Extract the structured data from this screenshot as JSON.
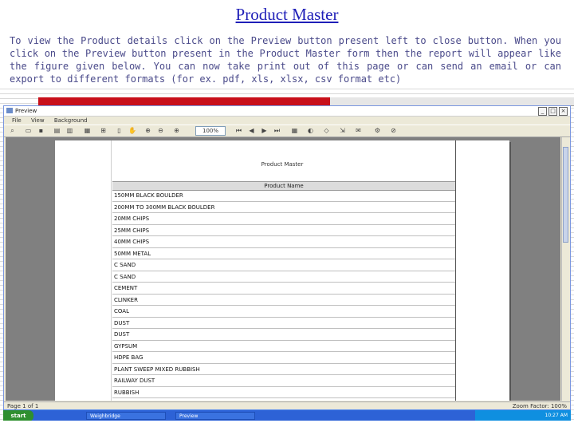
{
  "page_title": "Product Master",
  "intro_text": "To view the Product details click on the Preview button present left to close button. When you click on the Preview button present in the Product Master form then the report will appear like the figure given below. You can now take print out of this page or can send an email or can export to different formats (for ex. pdf, xls, xlsx, csv format etc)",
  "window": {
    "title": "Preview",
    "menu": [
      "File",
      "View",
      "Background"
    ],
    "zoom": "100%",
    "status_left": "Page 1 of 1",
    "status_right": "Zoom Factor: 100%"
  },
  "report": {
    "title": "Product Master",
    "column_header": "Product Name",
    "rows": [
      "150MM BLACK BOULDER",
      "200MM TO 300MM BLACK BOULDER",
      "20MM CHIPS",
      "25MM CHIPS",
      "40MM CHIPS",
      "50MM METAL",
      "C SAND",
      "C SAND",
      "CEMENT",
      "CLINKER",
      "COAL",
      "DUST",
      "DUST",
      "GYPSUM",
      "HDPE BAG",
      "PLANT SWEEP MIXED RUBBISH",
      "RAILWAY DUST",
      "RUBBISH"
    ]
  },
  "taskbar": {
    "start": "start",
    "task1": "Weighbridge",
    "task2": "Preview",
    "clock": "10:27 AM"
  },
  "colors": {
    "title": "#1f1fb8",
    "intro": "#4a4a8a",
    "banner": "#c8101a"
  }
}
